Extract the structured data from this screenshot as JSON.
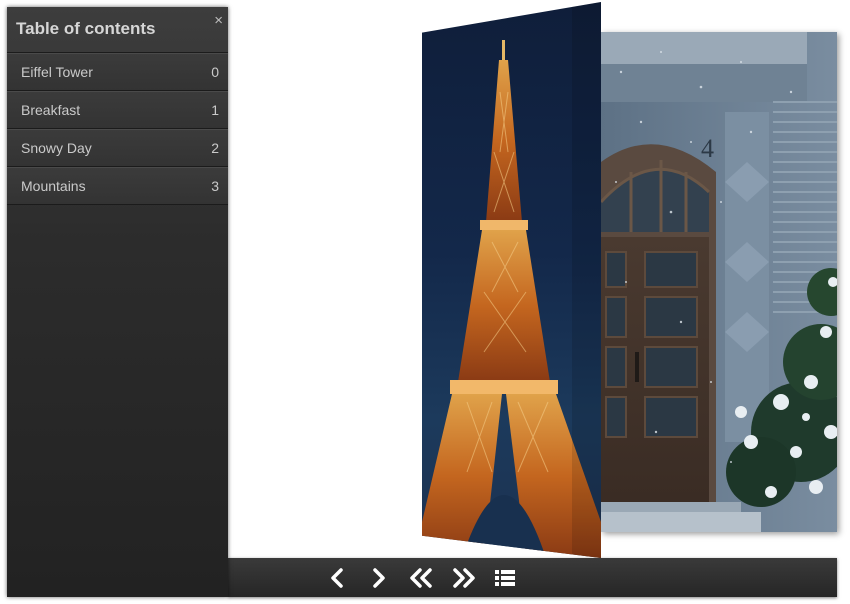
{
  "toc": {
    "title": "Table of contents",
    "close_label": "×",
    "items": [
      {
        "label": "Eiffel Tower",
        "page": "0"
      },
      {
        "label": "Breakfast",
        "page": "1"
      },
      {
        "label": "Snowy Day",
        "page": "2"
      },
      {
        "label": "Mountains",
        "page": "3"
      }
    ]
  },
  "book": {
    "left_page_image": "eiffel-tower-night-photo",
    "right_page_image": "snowy-door-photo",
    "door_number": "4"
  },
  "navbar": {
    "buttons": [
      {
        "name": "previous-page-button",
        "icon": "chevron-left-icon"
      },
      {
        "name": "next-page-button",
        "icon": "chevron-right-icon"
      },
      {
        "name": "first-page-button",
        "icon": "double-chevron-left-icon"
      },
      {
        "name": "last-page-button",
        "icon": "double-chevron-right-icon"
      },
      {
        "name": "toc-toggle-button",
        "icon": "list-icon"
      }
    ]
  },
  "colors": {
    "toc_background": "#2c2c2c",
    "navbar_background": "#2a2a2a",
    "icon_color": "#ffffff"
  }
}
